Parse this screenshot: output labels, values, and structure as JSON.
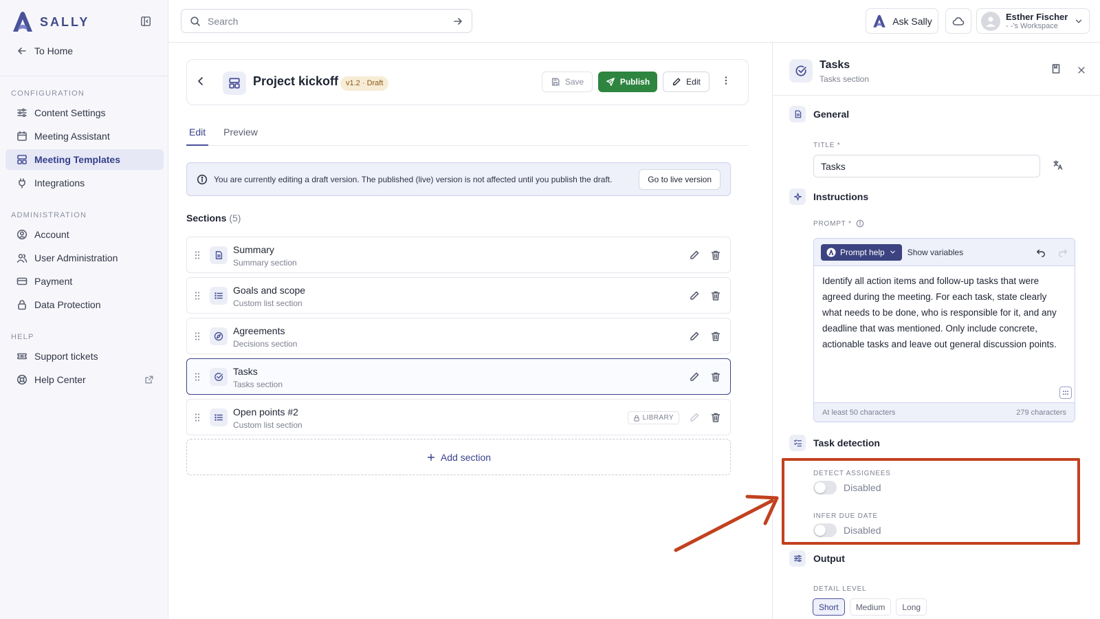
{
  "brand": {
    "name": "SALLY",
    "color": "#4a5299"
  },
  "sidebar": {
    "to_home": "To Home",
    "groups": [
      {
        "heading": "CONFIGURATION",
        "items": [
          {
            "label": "Content Settings",
            "icon": "sliders-icon"
          },
          {
            "label": "Meeting Assistant",
            "icon": "calendar-icon"
          },
          {
            "label": "Meeting Templates",
            "icon": "template-icon",
            "active": true
          },
          {
            "label": "Integrations",
            "icon": "plug-icon"
          }
        ]
      },
      {
        "heading": "ADMINISTRATION",
        "items": [
          {
            "label": "Account",
            "icon": "user-circle-icon"
          },
          {
            "label": "User Administration",
            "icon": "users-icon"
          },
          {
            "label": "Payment",
            "icon": "credit-card-icon"
          },
          {
            "label": "Data Protection",
            "icon": "lock-icon"
          }
        ]
      },
      {
        "heading": "HELP",
        "items": [
          {
            "label": "Support tickets",
            "icon": "ticket-icon"
          },
          {
            "label": "Help Center",
            "icon": "lifebuoy-icon",
            "external": true
          }
        ]
      }
    ]
  },
  "topbar": {
    "search_placeholder": "Search",
    "ask_label": "Ask Sally",
    "user": {
      "name": "Esther Fischer",
      "workspace": "- -'s Workspace"
    }
  },
  "header": {
    "title": "Project kickoff",
    "badge": "v1.2 · Draft",
    "save_label": "Save",
    "publish_label": "Publish",
    "edit_label": "Edit"
  },
  "tabs": [
    {
      "label": "Edit",
      "active": true
    },
    {
      "label": "Preview"
    }
  ],
  "notice": {
    "text": "You are currently editing a draft version. The published (live) version is not affected until you publish the draft.",
    "button": "Go to live version"
  },
  "sections": {
    "heading": "Sections",
    "count": "(5)",
    "items": [
      {
        "name": "Summary",
        "type": "Summary section",
        "icon": "document-icon"
      },
      {
        "name": "Goals and scope",
        "type": "Custom list section",
        "icon": "list-icon"
      },
      {
        "name": "Agreements",
        "type": "Decisions section",
        "icon": "compass-icon"
      },
      {
        "name": "Tasks",
        "type": "Tasks section",
        "icon": "check-circle-icon",
        "selected": true
      },
      {
        "name": "Open points #2",
        "type": "Custom list section",
        "icon": "list-icon",
        "library": "LIBRARY"
      }
    ],
    "add_label": "Add section"
  },
  "panel": {
    "title": "Tasks",
    "subtitle": "Tasks section",
    "general": {
      "heading": "General",
      "title_label": "TITLE *",
      "title_value": "Tasks"
    },
    "instructions": {
      "heading": "Instructions",
      "prompt_label": "PROMPT *",
      "prompt_help": "Prompt help",
      "show_variables": "Show variables",
      "prompt_text": "Identify all action items and follow-up tasks that were agreed during the meeting. For each task, state clearly what needs to be done, who is responsible for it, and any deadline that was mentioned. Only include concrete, actionable tasks and leave out general discussion points.",
      "min_chars": "At least 50 characters",
      "char_count": "279 characters"
    },
    "task_detection": {
      "heading": "Task detection",
      "detect_label": "DETECT ASSIGNEES",
      "detect_state": "Disabled",
      "due_label": "INFER DUE DATE",
      "due_state": "Disabled"
    },
    "output": {
      "heading": "Output",
      "detail_label": "DETAIL LEVEL",
      "options": [
        "Short",
        "Medium",
        "Long"
      ],
      "selected": "Short"
    }
  },
  "colors": {
    "publish": "#2e8540",
    "highlight": "#c2411f",
    "accent": "#363f8a",
    "badge_bg": "#f7ecd5"
  }
}
